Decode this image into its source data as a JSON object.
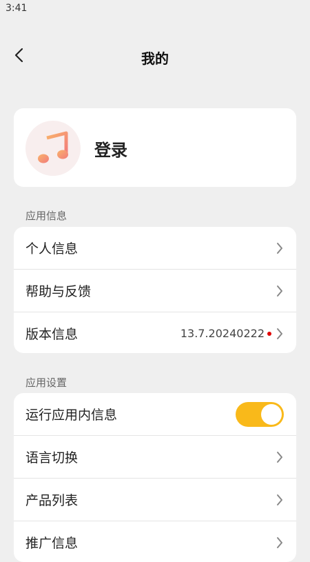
{
  "status_bar": {
    "time": "3:41"
  },
  "header": {
    "title": "我的",
    "back_icon": "chevron-left-icon"
  },
  "profile": {
    "avatar_icon": "music-note-icon",
    "login_label": "登录",
    "avatar_gradient": [
      "#f9b36b",
      "#f27b7b"
    ]
  },
  "sections": {
    "app_info": {
      "label": "应用信息",
      "items": [
        {
          "label": "个人信息"
        },
        {
          "label": "帮助与反馈"
        },
        {
          "label": "版本信息",
          "value": "13.7.20240222",
          "badge_color": "#e00000"
        }
      ]
    },
    "app_settings": {
      "label": "应用设置",
      "items": [
        {
          "label": "运行应用内信息",
          "toggle_on": true
        },
        {
          "label": "语言切换"
        },
        {
          "label": "产品列表"
        },
        {
          "label": "推广信息"
        }
      ]
    }
  },
  "colors": {
    "accent": "#f9b91a",
    "background": "#efefef",
    "card": "#ffffff"
  }
}
